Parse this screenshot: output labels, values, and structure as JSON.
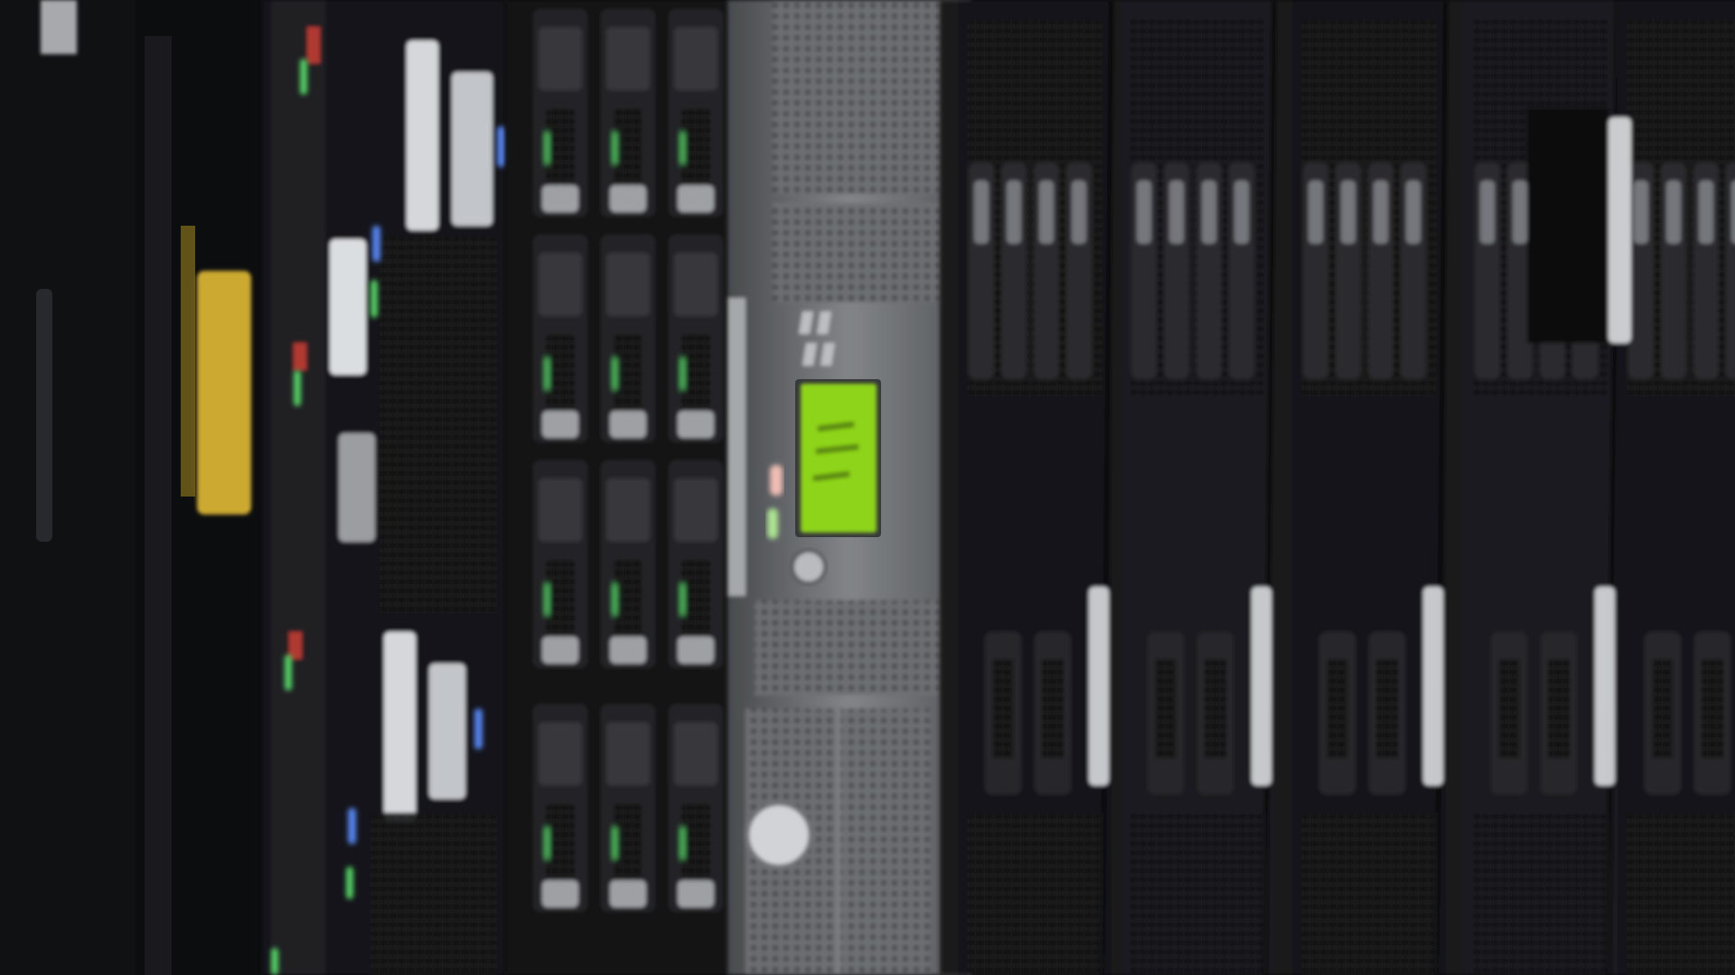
{
  "photo": {
    "subject": "server-rack-front-panels",
    "palette": {
      "chassis_black": "#141416",
      "chassis_dark": "#1d1e21",
      "bezel_silver": "#6f7275",
      "bezel_light": "#9a9c9f",
      "caddy_face": "#2a2b2e",
      "label_white": "#e9ecef",
      "label_yellow": "#d9b436",
      "led_green": "#58e06a",
      "led_blue": "#5a8cff",
      "led_red": "#ff4a3d",
      "lcd_green": "#97e21e"
    },
    "icons": [
      "logo-badge-icon",
      "power-button-icon",
      "lcd-panel-icon"
    ]
  }
}
